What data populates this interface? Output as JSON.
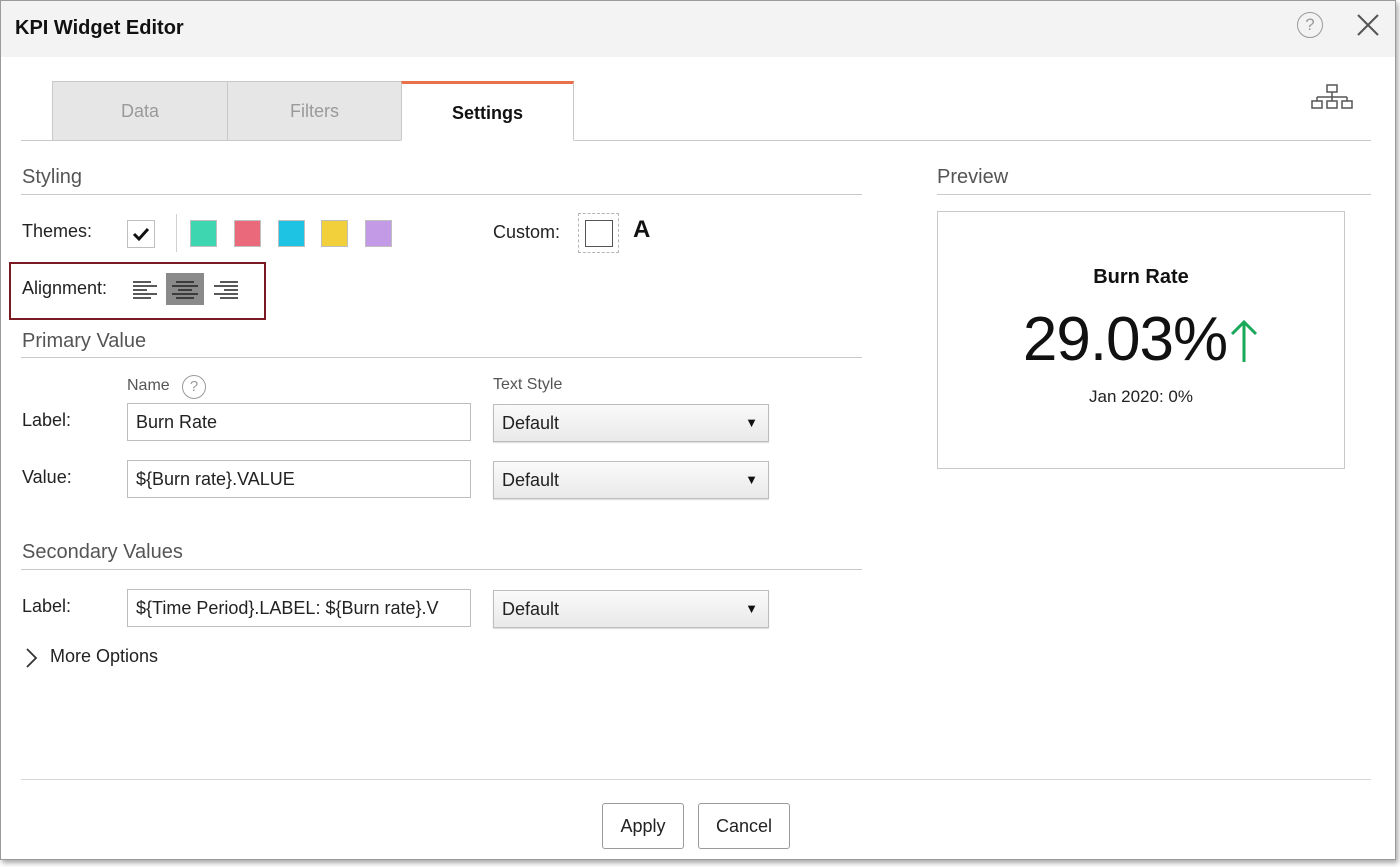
{
  "window": {
    "title": "KPI Widget Editor"
  },
  "tabs": [
    {
      "label": "Data"
    },
    {
      "label": "Filters"
    },
    {
      "label": "Settings",
      "active": true
    }
  ],
  "styling": {
    "section_title": "Styling",
    "themes_label": "Themes:",
    "theme_colors": [
      "#3dd6b0",
      "#ea6a7c",
      "#1ec2e2",
      "#f2d03b",
      "#c29ae6"
    ],
    "custom_label": "Custom:",
    "custom_font_glyph": "A",
    "alignment_label": "Alignment:",
    "alignment_selected": "center"
  },
  "primary_value": {
    "section_title": "Primary Value",
    "name_header": "Name",
    "text_style_header": "Text Style",
    "label_row": {
      "label": "Label:",
      "value": "Burn Rate",
      "style": "Default"
    },
    "value_row": {
      "label": "Value:",
      "value": "${Burn rate}.VALUE",
      "style": "Default"
    }
  },
  "secondary_values": {
    "section_title": "Secondary Values",
    "label_row": {
      "label": "Label:",
      "value": "${Time Period}.LABEL: ${Burn rate}.V",
      "style": "Default"
    }
  },
  "more_options": "More Options",
  "preview": {
    "section_title": "Preview",
    "title": "Burn Rate",
    "value": "29.03%",
    "trend": "up",
    "trend_color": "#1aa85a",
    "subtitle": "Jan 2020: 0%"
  },
  "footer": {
    "apply_label": "Apply",
    "cancel_label": "Cancel"
  },
  "colors": {
    "active_tab_accent": "#e8714a",
    "highlight_border": "#7a1a22"
  }
}
